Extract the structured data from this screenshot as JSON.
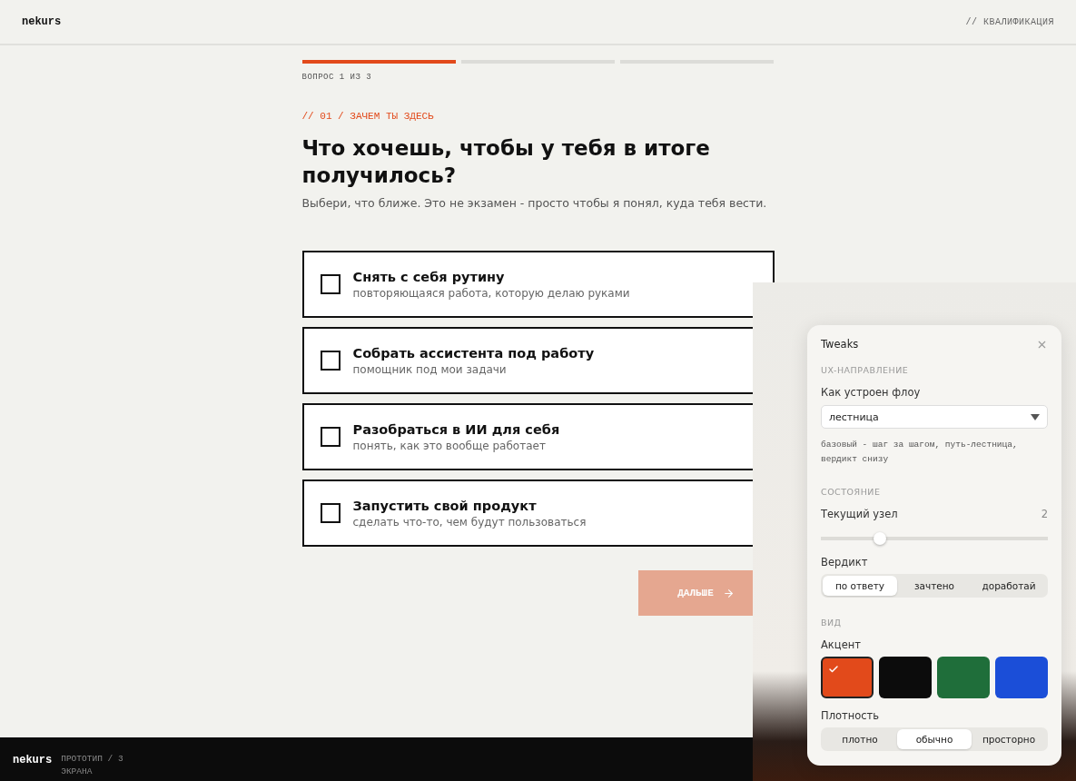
{
  "header": {
    "logo": "nekurs",
    "section": "// КВАЛИФИКАЦИЯ"
  },
  "progress": {
    "segments": [
      {
        "active": true
      },
      {
        "active": false
      },
      {
        "active": false
      }
    ],
    "label": "ВОПРОС 1 ИЗ 3"
  },
  "question": {
    "eyebrow": "// 01 / ЗАЧЕМ ТЫ ЗДЕСЬ",
    "title": "Что хочешь, чтобы у тебя в итоге получилось?",
    "subtitle": "Выбери, что ближе. Это не экзамен - просто чтобы я понял, куда тебя вести."
  },
  "options": [
    {
      "title": "Снять с себя рутину",
      "hint": "повторяющаяся работа, которую делаю руками",
      "checked": false
    },
    {
      "title": "Собрать ассистента под работу",
      "hint": "помощник под мои задачи",
      "checked": false
    },
    {
      "title": "Разобраться в ИИ для себя",
      "hint": "понять, как это вообще работает",
      "checked": false
    },
    {
      "title": "Запустить свой продукт",
      "hint": "сделать что-то, чем будут пользоваться",
      "checked": false
    }
  ],
  "next_button": {
    "label": "ДАЛЬШЕ",
    "disabled": true
  },
  "footer": {
    "logo": "nekurs",
    "caption": "ПРОТОТИП / 3 ЭКРАНА"
  },
  "tweaks": {
    "title": "Tweaks",
    "sections": [
      {
        "heading": "UX-НАПРАВЛЕНИЕ",
        "controls": [
          {
            "kind": "select",
            "label": "Как устроен флоу",
            "value": "лестница",
            "note": "базовый - шаг за шагом, путь-лестница, вердикт снизу"
          }
        ]
      },
      {
        "heading": "СОСТОЯНИЕ",
        "controls": [
          {
            "kind": "slider",
            "label": "Текущий узел",
            "reading": "2",
            "level": 0.26
          },
          {
            "kind": "segmented",
            "label": "Вердикт",
            "options": [
              {
                "label": "по ответу",
                "selected": true
              },
              {
                "label": "зачтено",
                "selected": false
              },
              {
                "label": "доработай",
                "selected": false
              }
            ]
          }
        ]
      },
      {
        "heading": "ВИД",
        "controls": [
          {
            "kind": "swatches",
            "label": "Акцент",
            "options": [
              {
                "color": "#e24a1b",
                "selected": true
              },
              {
                "color": "#0c0c0c",
                "selected": false
              },
              {
                "color": "#1f6e3a",
                "selected": false
              },
              {
                "color": "#1b4ed8",
                "selected": false
              }
            ]
          },
          {
            "kind": "segmented",
            "label": "Плотность",
            "options": [
              {
                "label": "плотно",
                "selected": false
              },
              {
                "label": "обычно",
                "selected": true
              },
              {
                "label": "просторно",
                "selected": false
              }
            ]
          }
        ]
      }
    ]
  }
}
